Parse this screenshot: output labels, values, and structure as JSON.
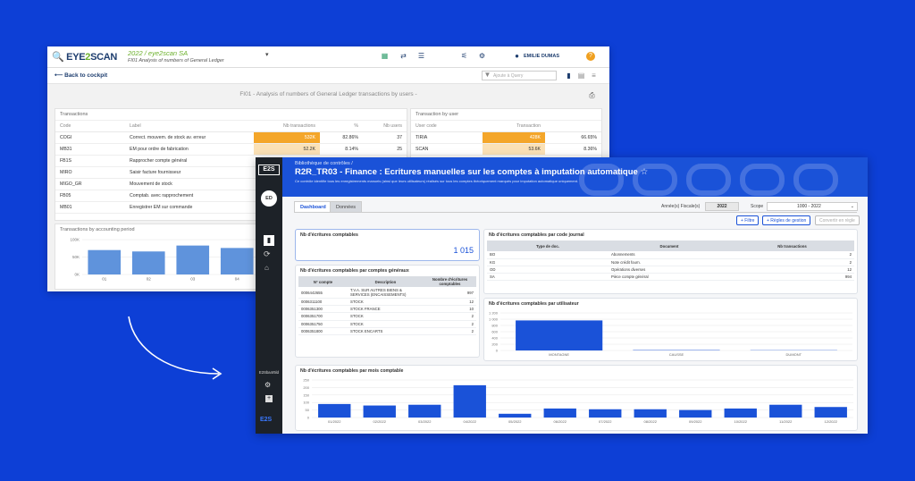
{
  "window1": {
    "company": "2022 / eye2scan SA",
    "subtitle": "FI01 Analysis of numbers of General Ledger",
    "user": "EMILIE DUMAS",
    "help": "?",
    "back": "⟵ Back to cockpit",
    "search_placeholder": "Ajoute à Query",
    "heading": "FI01 - Analysis of numbers of General Ledger transactions by users -",
    "transactions": {
      "title": "Transactions",
      "columns": [
        "Code",
        "Label",
        "Nb transactions",
        "%",
        "Nb users"
      ],
      "rows": [
        {
          "code": "COGI",
          "label": "Correct. mouvem. de stock av. erreur",
          "nb": "532K",
          "pct": "82.86%",
          "users": "37"
        },
        {
          "code": "MB31",
          "label": "EM pour ordre de fabrication",
          "nb": "52.2K",
          "pct": "8.14%",
          "users": "25"
        },
        {
          "code": "FB1S",
          "label": "Rapprocher compte général",
          "nb": "",
          "pct": "",
          "users": ""
        },
        {
          "code": "MIRO",
          "label": "Saisir facture fournisseur",
          "nb": "",
          "pct": "",
          "users": ""
        },
        {
          "code": "MIGO_GR",
          "label": "Mouvement de stock",
          "nb": "",
          "pct": "",
          "users": ""
        },
        {
          "code": "FB05",
          "label": "Comptab. avec rapprochement",
          "nb": "",
          "pct": "",
          "users": ""
        },
        {
          "code": "MB01",
          "label": "Enregistrer EM sur commande",
          "nb": "",
          "pct": "",
          "users": ""
        }
      ]
    },
    "by_user": {
      "title": "Transaction by user",
      "columns": [
        "User code",
        "Transaction",
        ""
      ],
      "rows": [
        {
          "user": "TIRIA",
          "nb": "428K",
          "pct": "66.65%"
        },
        {
          "user": "SCAN",
          "nb": "53.6K",
          "pct": "8.36%"
        }
      ]
    },
    "period_chart": {
      "title": "Transactions by accounting period",
      "y_ticks": [
        "100K",
        "50K",
        "0K"
      ],
      "x_ticks": [
        "01",
        "02",
        "03",
        "04"
      ]
    }
  },
  "window2": {
    "breadcrumb": "Bibliothèque de contrôles /",
    "title": "R2R_TR03 - Finance : Ecritures manuelles sur les comptes à imputation automatique",
    "star": "☆",
    "description": "Ce contrôle identifie tous les enregistrements manuels (ainsi que leurs utilisateurs) réalisés sur tous les comptes théoriquement marqués pour imputation automatique uniquement.",
    "sidebar": {
      "logo": "E2S",
      "avatar": "ED",
      "bottom_label": "E2Sba4r5ld",
      "bottom_logo": "E2S"
    },
    "tabs": [
      "Dashboard",
      "Données"
    ],
    "year_label": "Année(s) Fiscale(s)",
    "year_value": "2022",
    "scope_label": "Scope",
    "scope_value": "1000 - 2022",
    "buttons": {
      "filter": "+ Filtre",
      "rules": "+ Règles de gestion",
      "convert": "Convertir en règle"
    },
    "kpi": {
      "title": "Nb d'écritures comptables",
      "value": "1 015"
    },
    "by_account": {
      "title": "Nb d'écritures comptables par comptes généraux",
      "columns": [
        "N° compte",
        "Description",
        "Nombre d'écritures comptables"
      ],
      "rows": [
        [
          "0006442655",
          "T.V.A. SUR AUTRES BIENS & SERVICES (ENCAISSEMENTS)",
          "997"
        ],
        [
          "0006311100",
          "STOCK",
          "12"
        ],
        [
          "0006351300",
          "STOCK FRANCE",
          "10"
        ],
        [
          "0006351700",
          "STOCK",
          "2"
        ],
        [
          "0006351750",
          "STOCK",
          "2"
        ],
        [
          "0006351800",
          "STOCK ENCARTS",
          "2"
        ]
      ]
    },
    "by_journal": {
      "title": "Nb d'écritures comptables par code journal",
      "columns": [
        "Type de doc.",
        "Document",
        "Nb transactions"
      ],
      "rows": [
        [
          "BO",
          "Abonnements",
          "2"
        ],
        [
          "KG",
          "Note crédit fourn.",
          "2"
        ],
        [
          "OD",
          "Opérations diverses",
          "12"
        ],
        [
          "SA",
          "Pièce compte général",
          "994"
        ]
      ]
    },
    "by_user_chart": {
      "title": "Nb d'écritures comptables par utilisateur"
    },
    "by_month_chart": {
      "title": "Nb d'écritures comptables par mois comptable"
    }
  },
  "chart_data": [
    {
      "type": "bar",
      "title": "Transactions by accounting period",
      "categories": [
        "01",
        "02",
        "03",
        "04"
      ],
      "values": [
        70000,
        66000,
        83000,
        76000
      ],
      "ylim": [
        0,
        100000
      ],
      "y_ticks": [
        "100K",
        "50K",
        "0K"
      ]
    },
    {
      "type": "bar",
      "title": "Nb d'écritures comptables par utilisateur",
      "categories": [
        "MONTAGNE",
        "CAUSSE",
        "DUMONT"
      ],
      "values": [
        960,
        12,
        8
      ],
      "ylim": [
        0,
        1200
      ],
      "y_ticks": [
        "1 200",
        "1 000",
        "800",
        "600",
        "400",
        "200",
        "0"
      ]
    },
    {
      "type": "bar",
      "title": "Nb d'écritures comptables par mois comptable",
      "categories": [
        "01/2022",
        "02/2022",
        "03/2022",
        "04/2022",
        "05/2022",
        "06/2022",
        "07/2022",
        "08/2022",
        "09/2022",
        "10/2022",
        "11/2022",
        "12/2022"
      ],
      "values": [
        90,
        80,
        85,
        215,
        25,
        60,
        55,
        55,
        50,
        60,
        85,
        70
      ],
      "ylim": [
        0,
        250
      ],
      "y_ticks": [
        "250",
        "200",
        "150",
        "100",
        "50",
        "0"
      ]
    }
  ],
  "colors": {
    "background": "#0d3fd6",
    "brand_blue": "#1a52d8",
    "orange": "#f4a62a",
    "green": "#6bb02b"
  }
}
